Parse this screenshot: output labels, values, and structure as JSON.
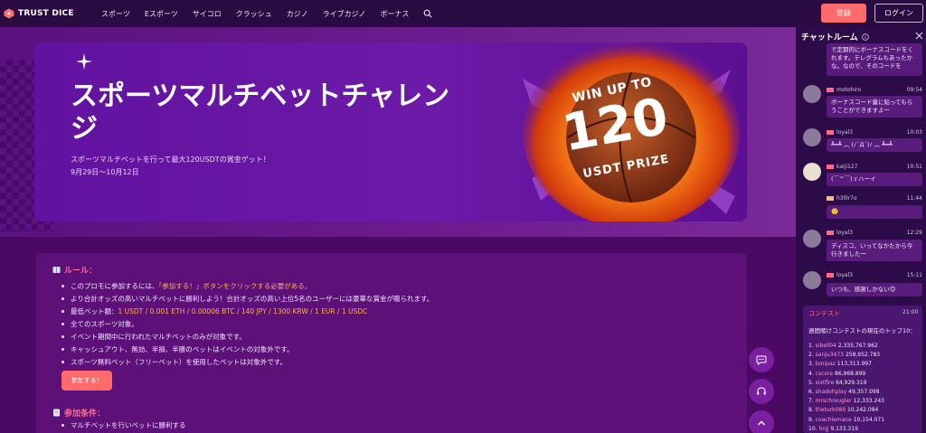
{
  "brand": {
    "name": "TRUST DICE"
  },
  "nav": [
    "スポーツ",
    "Eスポーツ",
    "サイコロ",
    "クラッシュ",
    "カジノ",
    "ライブカジノ",
    "ボーナス"
  ],
  "auth": {
    "register": "登録",
    "login": "ログイン"
  },
  "hero": {
    "title": "スポーツマルチベットチャレンジ",
    "subtitle": "スポーツマルチベットを行って最大120USDTの賞金ゲット！",
    "date": "9月29日〜10月12日",
    "prize_line1": "WIN UP TO",
    "prize_line2": "120",
    "prize_line3": "USDT PRIZE"
  },
  "rules": {
    "heading": "ルール：",
    "item0_prefix": "このプロモに参加するには、",
    "item0_highlight": "「参加する！」ボタンをクリックする必要がある。",
    "item1": "より合計オッズの高いマルチベットに勝利しよう！合計オッズの高い上位5名のユーザーには豪華な賞金が贈られます。",
    "item2_prefix": "最低ベット額：",
    "item2_highlight": "1 USDT / 0.001 ETH / 0.00006 BTC / 140 JPY / 1300 KRW / 1 EUR / 1 USDC",
    "item3": "全てのスポーツ対象。",
    "item4": "イベント期間中に行われたマルチベットのみが対象です。",
    "item5": "キャッシュアウト、無効、半損、半勝のベットはイベントの対象外です。",
    "item6": "スポーツ無料ベット（フリーベット）を使用したベットは対象外です。",
    "join_button": "参加する！"
  },
  "conditions": {
    "heading": "参加条件：",
    "items": [
      "マルチベットを行いベットに勝利する"
    ]
  },
  "chat": {
    "title": "チャットルーム",
    "messages": [
      {
        "user": "",
        "time": "",
        "text": "で定期的にボーナスコードをくれます。テレグラムもあったかな。なので、そのコードを"
      },
      {
        "user": "motohiro",
        "time": "09:54",
        "text": "ボーナスコード量に貼ってもらうことができますよー"
      },
      {
        "user": "loyal3",
        "time": "10:03",
        "text": "┻━┻ ︵ (ﾉ`Д´)ﾉ ︵ ┻━┻"
      },
      {
        "user": "kaiji127",
        "time": "10:51",
        "text": "(￣^￣)ゞハーイ"
      },
      {
        "user": "h3lllr7o",
        "time": "11:44",
        "text": "🙂"
      },
      {
        "user": "loyal3",
        "time": "12:29",
        "text": "ディスコ、いってなかたから今行きましたー"
      },
      {
        "user": "loyal3",
        "time": "15:11",
        "text": "いつも、感謝しかない😊"
      }
    ],
    "contest": {
      "title": "コンテスト",
      "time": "21:00",
      "subtitle": "週間賭けコンテストの現在のトップ10：",
      "leaderboard": [
        {
          "rank": "1.",
          "name": "sibell04",
          "amount": "2,335,767.962"
        },
        {
          "rank": "2.",
          "name": "sanju3473",
          "amount": "258,952.783"
        },
        {
          "rank": "3.",
          "name": "tonipaz",
          "amount": "113,313.997"
        },
        {
          "rank": "4.",
          "name": "cscore",
          "amount": "86,968.899"
        },
        {
          "rank": "5.",
          "name": "sixtfire",
          "amount": "64,929.319"
        },
        {
          "rank": "6.",
          "name": "shadohplay",
          "amount": "49,357.098"
        },
        {
          "rank": "7.",
          "name": "mrschreugler",
          "amount": "12,333.243"
        },
        {
          "rank": "8.",
          "name": "theturk089",
          "amount": "10,242.084"
        },
        {
          "rank": "9.",
          "name": "coachlemane",
          "amount": "10,154.071"
        },
        {
          "rank": "10.",
          "name": "hnjj",
          "amount": "9,133.319"
        }
      ]
    }
  },
  "colors": {
    "accent": "#ff6b6b",
    "highlight": "#ffb14a",
    "nav_bg": "#2a0b41",
    "chat_bg": "#2d0a48"
  },
  "icons": [
    "dice-logo-icon",
    "search-icon",
    "book-icon",
    "info-icon",
    "close-icon",
    "chat-icon",
    "headset-icon",
    "chevron-up-icon",
    "flag-icon"
  ]
}
